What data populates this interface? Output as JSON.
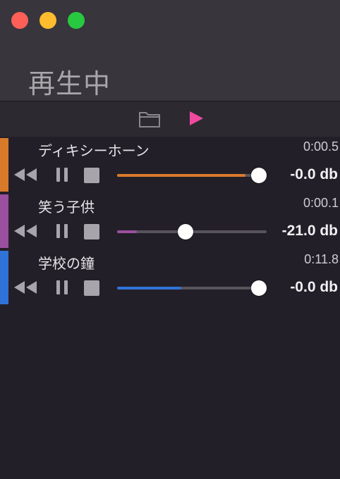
{
  "window": {
    "title": "再生中"
  },
  "toolbar": {
    "folder_icon": "folder-icon",
    "play_icon": "play-icon",
    "play_color": "#f04aa0"
  },
  "tracks": [
    {
      "name": "ディキシーホーン",
      "time": "0:00.5",
      "color": "#d97a2b",
      "volume_label": "-0.0 db",
      "volume_level": 1.0,
      "fill_level": 0.86
    },
    {
      "name": "笑う子供",
      "time": "0:00.1",
      "color": "#9b4f9f",
      "volume_label": "-21.0 db",
      "volume_level": 0.45,
      "fill_level": 0.13
    },
    {
      "name": "学校の鐘",
      "time": "0:11.8",
      "color": "#2f73d8",
      "volume_label": "-0.0 db",
      "volume_level": 1.0,
      "fill_level": 0.43
    }
  ]
}
